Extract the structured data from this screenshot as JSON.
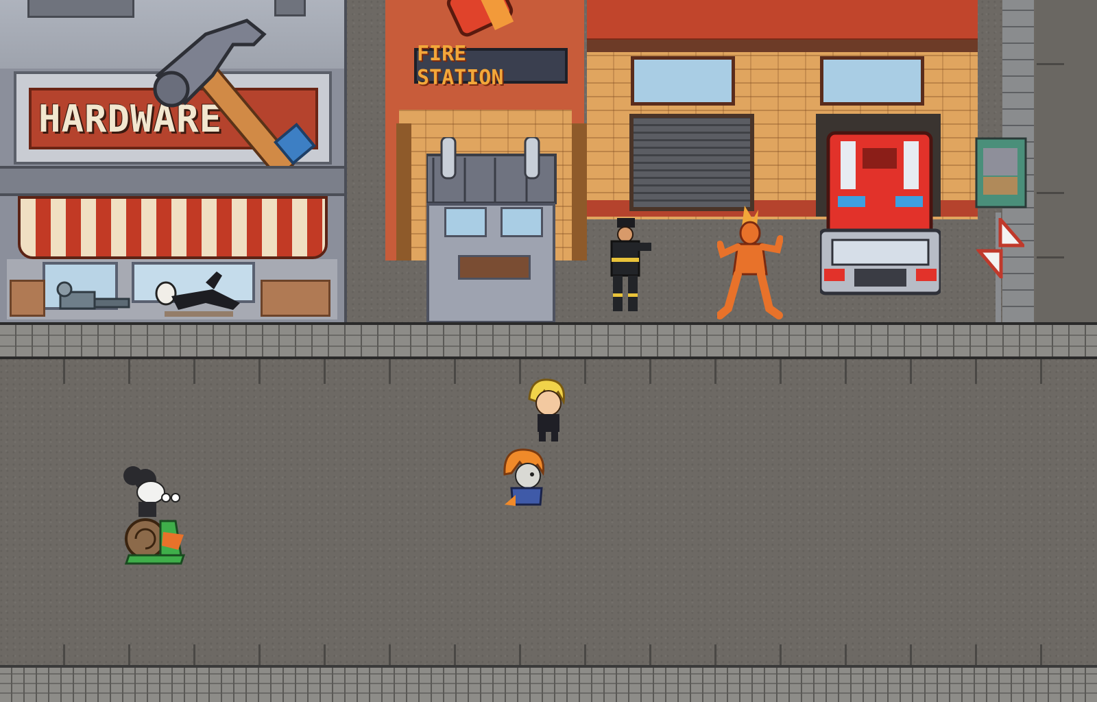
{
  "scene": {
    "hardware_sign": "HARDWARE",
    "fire_station_sign": "FIRE STATION"
  },
  "colors": {
    "asphalt": "#6d6964",
    "brick": "#e0a55f",
    "fire_red": "#c1452c",
    "awning_red": "#c23a25",
    "awning_cream": "#f0dfc2",
    "sign_orange": "#f2a73a"
  },
  "characters": [
    {
      "name": "blonde-hero",
      "icon": "player-blonde-icon"
    },
    {
      "name": "orange-haired-companion",
      "icon": "companion-orange-hair-icon"
    },
    {
      "name": "mouse-on-snail",
      "icon": "mouse-riding-snail-icon"
    },
    {
      "name": "firefighter",
      "icon": "firefighter-icon"
    },
    {
      "name": "fire-elemental",
      "icon": "fire-elemental-icon"
    },
    {
      "name": "fallen-figure",
      "icon": "knocked-out-figure-icon"
    },
    {
      "name": "broken-robot",
      "icon": "broken-robot-icon"
    }
  ]
}
